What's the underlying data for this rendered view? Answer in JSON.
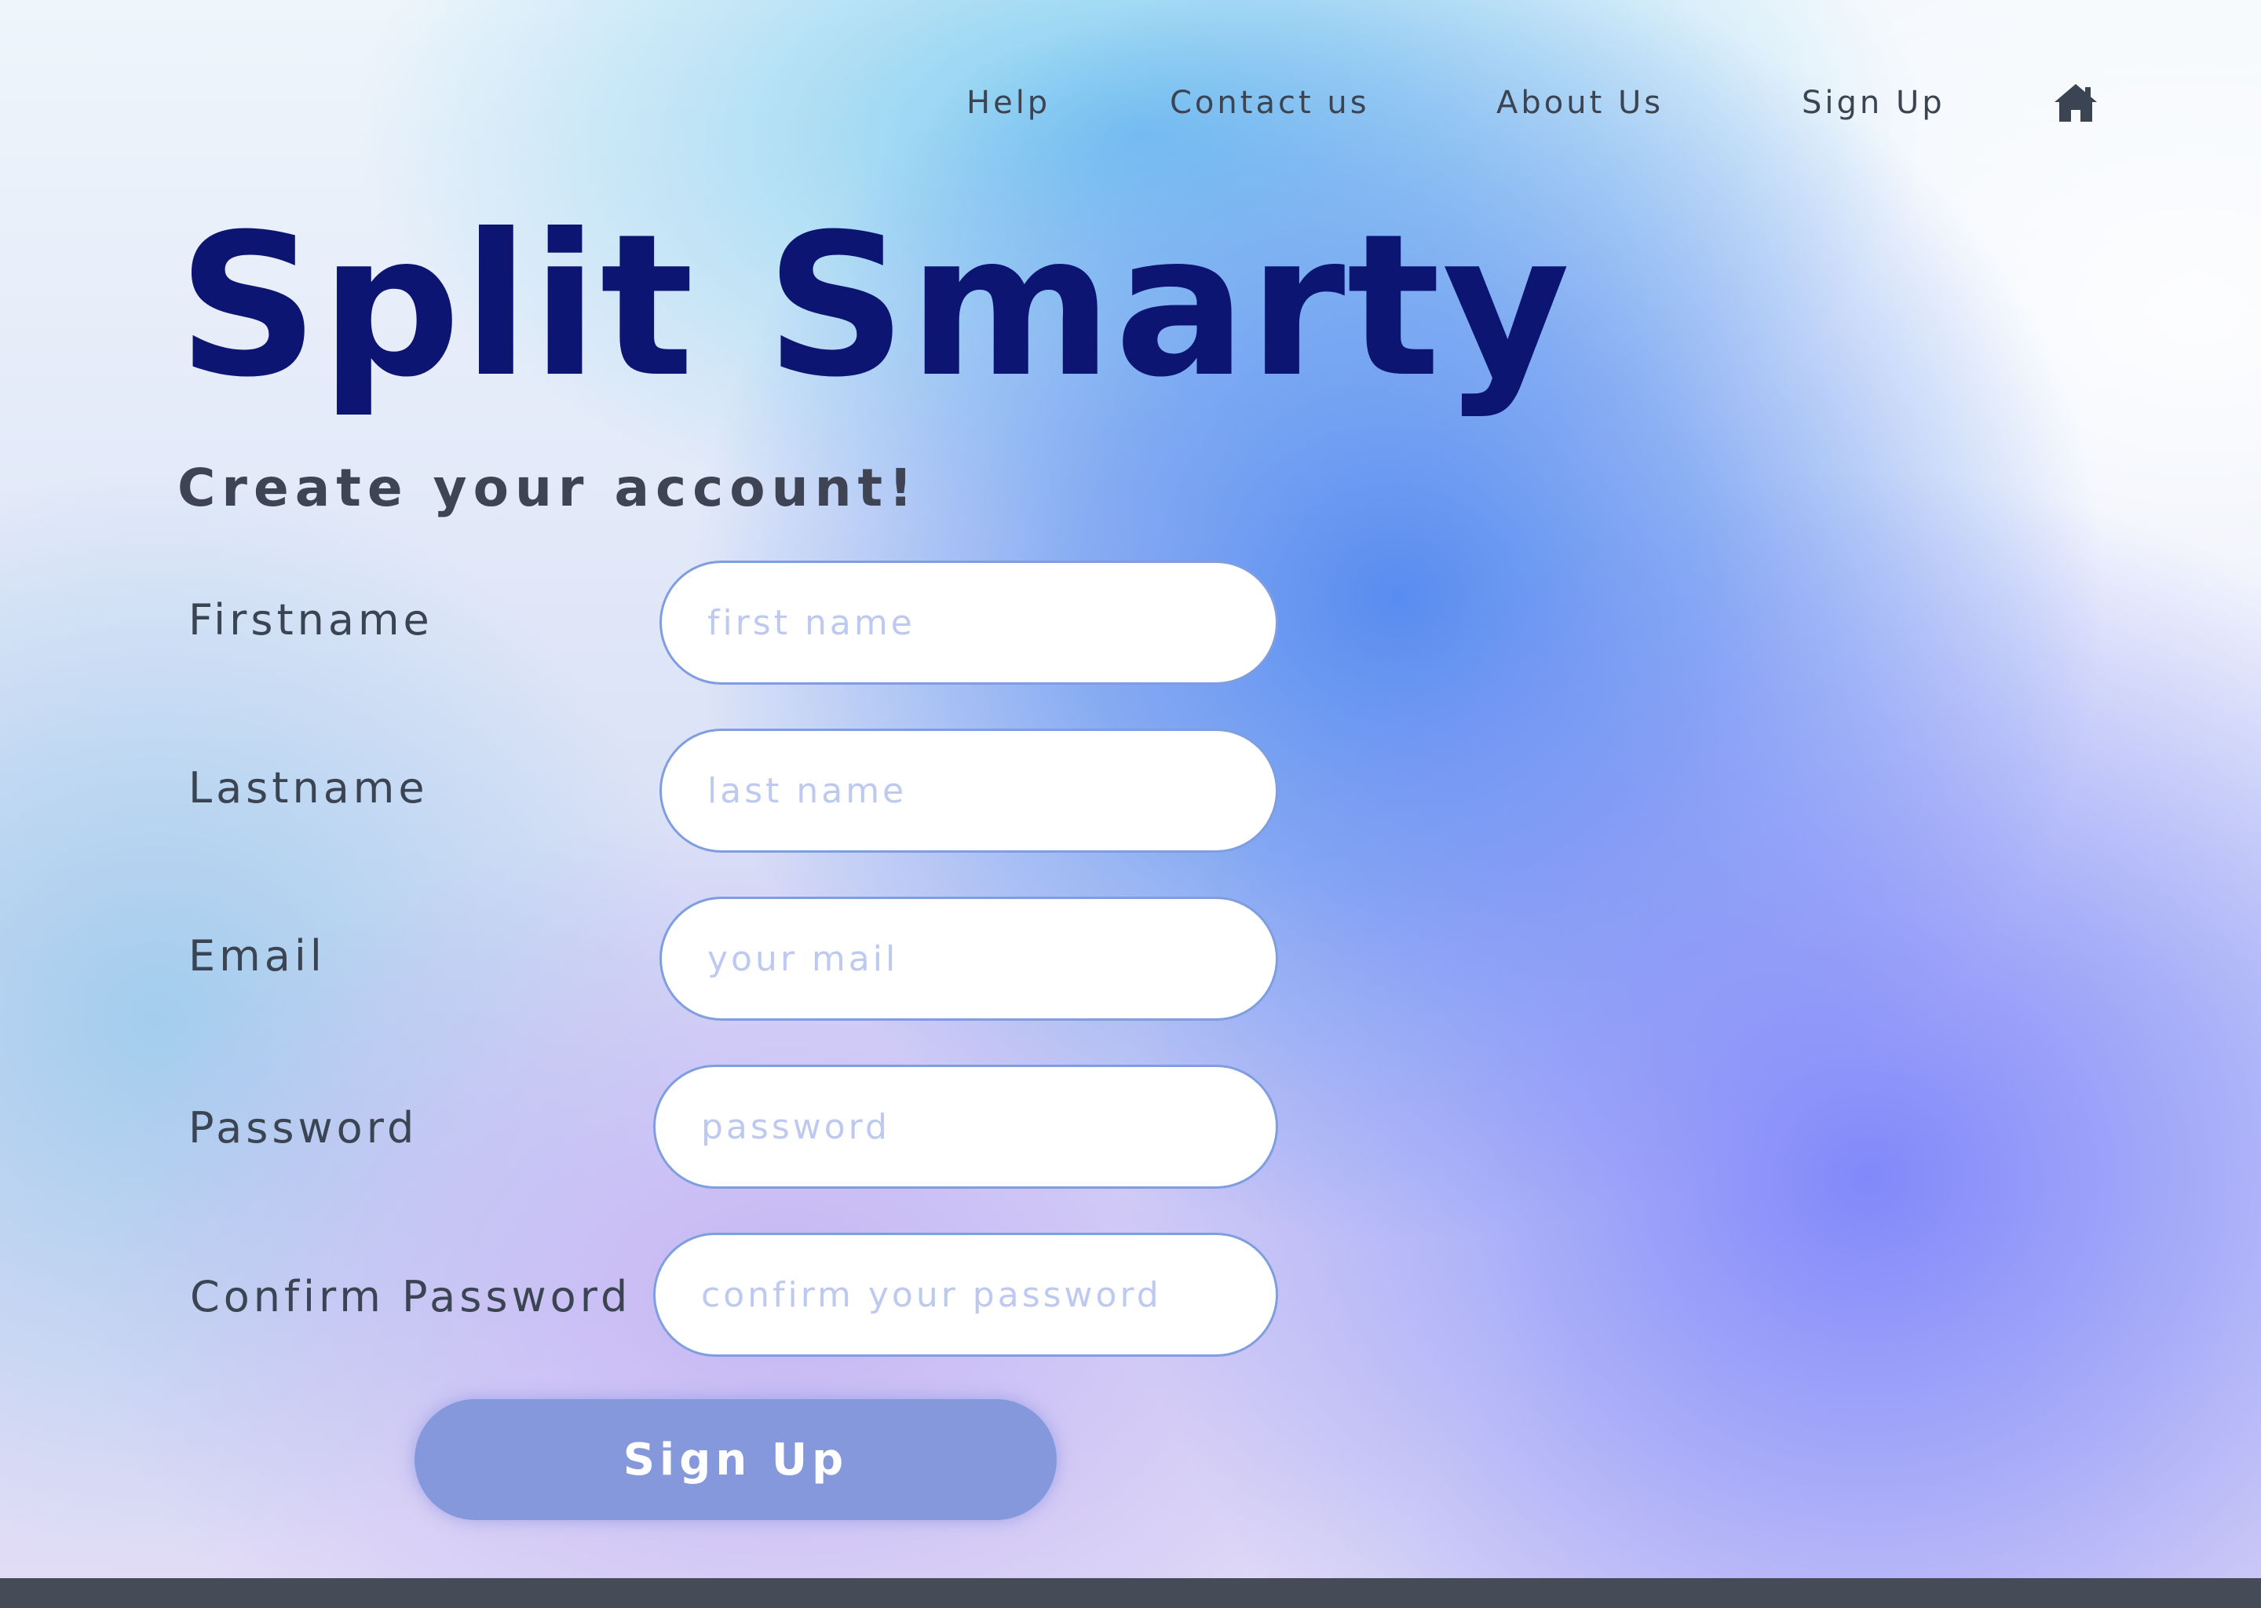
{
  "nav": {
    "items": [
      {
        "label": "Help"
      },
      {
        "label": "Contact us"
      },
      {
        "label": "About Us"
      },
      {
        "label": "Sign Up"
      }
    ],
    "home_icon": "home-icon"
  },
  "brand": {
    "title": "Split Smarty"
  },
  "form": {
    "heading": "Create your account!",
    "fields": [
      {
        "label": "Firstname",
        "placeholder": "first name",
        "value": ""
      },
      {
        "label": "Lastname",
        "placeholder": "last name",
        "value": ""
      },
      {
        "label": "Email",
        "placeholder": "your mail",
        "value": ""
      },
      {
        "label": "Password",
        "placeholder": "password",
        "value": ""
      },
      {
        "label": "Confirm Password",
        "placeholder": "confirm your password",
        "value": ""
      }
    ],
    "submit_label": "Sign Up"
  },
  "colors": {
    "brand_title": "#0c1572",
    "text": "#3b4452",
    "input_border": "#7f9ee0",
    "placeholder": "#bdc9f0",
    "button": "#8598dc",
    "footer": "#464c57"
  }
}
